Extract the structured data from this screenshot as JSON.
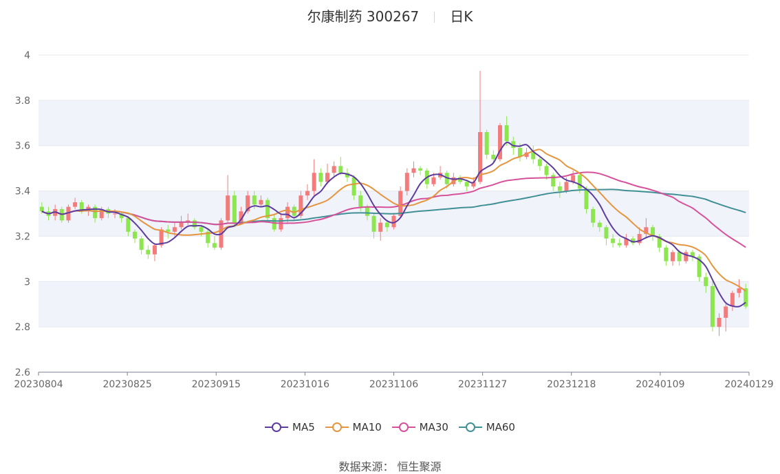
{
  "title": {
    "name": "尔康制药 300267",
    "period": "日K"
  },
  "source": "数据来源： 恒生聚源",
  "colors": {
    "up": "#f37b7b",
    "down": "#8de64f",
    "ma5": "#5b3b9e",
    "ma10": "#e5953f",
    "ma30": "#d6519a",
    "ma60": "#3f8f95",
    "band": "#f1f3fa",
    "grid": "#e6e8f0",
    "axis": "#7a7f8c"
  },
  "chart_data": {
    "type": "candlestick",
    "y_ticks": [
      "4",
      "3.8",
      "3.6",
      "3.4",
      "3.2",
      "3",
      "2.8",
      "2.6"
    ],
    "ylim": [
      2.6,
      4.0
    ],
    "x_ticks": [
      "20230804",
      "20230825",
      "20230915",
      "20231016",
      "20231106",
      "20231127",
      "20231218",
      "20240109",
      "20240129"
    ],
    "legend": [
      "MA5",
      "MA10",
      "MA30",
      "MA60"
    ],
    "candles": [
      [
        3.33,
        3.31,
        3.35,
        3.3
      ],
      [
        3.31,
        3.29,
        3.33,
        3.27
      ],
      [
        3.29,
        3.32,
        3.34,
        3.27
      ],
      [
        3.32,
        3.27,
        3.33,
        3.26
      ],
      [
        3.27,
        3.33,
        3.34,
        3.26
      ],
      [
        3.33,
        3.35,
        3.37,
        3.32
      ],
      [
        3.35,
        3.31,
        3.36,
        3.3
      ],
      [
        3.31,
        3.33,
        3.34,
        3.29
      ],
      [
        3.33,
        3.28,
        3.34,
        3.26
      ],
      [
        3.28,
        3.32,
        3.33,
        3.27
      ],
      [
        3.32,
        3.3,
        3.33,
        3.28
      ],
      [
        3.3,
        3.3,
        3.32,
        3.28
      ],
      [
        3.3,
        3.28,
        3.31,
        3.26
      ],
      [
        3.28,
        3.22,
        3.29,
        3.2
      ],
      [
        3.22,
        3.19,
        3.23,
        3.17
      ],
      [
        3.19,
        3.14,
        3.2,
        3.12
      ],
      [
        3.14,
        3.12,
        3.16,
        3.1
      ],
      [
        3.12,
        3.16,
        3.17,
        3.09
      ],
      [
        3.16,
        3.23,
        3.24,
        3.15
      ],
      [
        3.23,
        3.22,
        3.25,
        3.19
      ],
      [
        3.22,
        3.24,
        3.26,
        3.2
      ],
      [
        3.24,
        3.26,
        3.29,
        3.23
      ],
      [
        3.26,
        3.27,
        3.3,
        3.25
      ],
      [
        3.27,
        3.24,
        3.28,
        3.23
      ],
      [
        3.24,
        3.22,
        3.25,
        3.2
      ],
      [
        3.22,
        3.17,
        3.23,
        3.15
      ],
      [
        3.17,
        3.15,
        3.2,
        3.14
      ],
      [
        3.15,
        3.27,
        3.28,
        3.14
      ],
      [
        3.27,
        3.38,
        3.47,
        3.26
      ],
      [
        3.38,
        3.26,
        3.4,
        3.24
      ],
      [
        3.26,
        3.31,
        3.33,
        3.25
      ],
      [
        3.31,
        3.38,
        3.4,
        3.3
      ],
      [
        3.38,
        3.34,
        3.4,
        3.32
      ],
      [
        3.34,
        3.36,
        3.38,
        3.33
      ],
      [
        3.36,
        3.28,
        3.37,
        3.26
      ],
      [
        3.28,
        3.23,
        3.3,
        3.22
      ],
      [
        3.23,
        3.28,
        3.3,
        3.22
      ],
      [
        3.28,
        3.33,
        3.35,
        3.26
      ],
      [
        3.33,
        3.29,
        3.34,
        3.27
      ],
      [
        3.29,
        3.38,
        3.4,
        3.28
      ],
      [
        3.38,
        3.4,
        3.43,
        3.36
      ],
      [
        3.4,
        3.48,
        3.54,
        3.38
      ],
      [
        3.48,
        3.44,
        3.5,
        3.42
      ],
      [
        3.44,
        3.48,
        3.52,
        3.43
      ],
      [
        3.48,
        3.51,
        3.53,
        3.46
      ],
      [
        3.51,
        3.48,
        3.55,
        3.47
      ],
      [
        3.48,
        3.46,
        3.5,
        3.44
      ],
      [
        3.46,
        3.38,
        3.47,
        3.36
      ],
      [
        3.38,
        3.33,
        3.4,
        3.31
      ],
      [
        3.33,
        3.29,
        3.34,
        3.27
      ],
      [
        3.29,
        3.22,
        3.3,
        3.19
      ],
      [
        3.22,
        3.26,
        3.28,
        3.18
      ],
      [
        3.26,
        3.24,
        3.27,
        3.22
      ],
      [
        3.24,
        3.29,
        3.3,
        3.23
      ],
      [
        3.29,
        3.4,
        3.42,
        3.28
      ],
      [
        3.4,
        3.48,
        3.5,
        3.38
      ],
      [
        3.48,
        3.5,
        3.53,
        3.46
      ],
      [
        3.5,
        3.49,
        3.51,
        3.47
      ],
      [
        3.49,
        3.43,
        3.5,
        3.41
      ],
      [
        3.43,
        3.46,
        3.48,
        3.42
      ],
      [
        3.46,
        3.48,
        3.51,
        3.45
      ],
      [
        3.48,
        3.43,
        3.49,
        3.41
      ],
      [
        3.43,
        3.46,
        3.48,
        3.42
      ],
      [
        3.46,
        3.44,
        3.47,
        3.43
      ],
      [
        3.44,
        3.42,
        3.45,
        3.4
      ],
      [
        3.42,
        3.44,
        3.46,
        3.41
      ],
      [
        3.44,
        3.66,
        3.93,
        3.43
      ],
      [
        3.66,
        3.56,
        3.67,
        3.54
      ],
      [
        3.56,
        3.54,
        3.58,
        3.52
      ],
      [
        3.54,
        3.69,
        3.7,
        3.53
      ],
      [
        3.69,
        3.62,
        3.73,
        3.6
      ],
      [
        3.62,
        3.59,
        3.64,
        3.56
      ],
      [
        3.59,
        3.55,
        3.61,
        3.53
      ],
      [
        3.55,
        3.57,
        3.59,
        3.54
      ],
      [
        3.57,
        3.54,
        3.6,
        3.52
      ],
      [
        3.54,
        3.51,
        3.55,
        3.49
      ],
      [
        3.51,
        3.47,
        3.52,
        3.45
      ],
      [
        3.47,
        3.42,
        3.48,
        3.4
      ],
      [
        3.42,
        3.4,
        3.44,
        3.37
      ],
      [
        3.4,
        3.44,
        3.46,
        3.39
      ],
      [
        3.44,
        3.47,
        3.49,
        3.43
      ],
      [
        3.47,
        3.41,
        3.48,
        3.39
      ],
      [
        3.41,
        3.32,
        3.42,
        3.3
      ],
      [
        3.32,
        3.26,
        3.33,
        3.24
      ],
      [
        3.26,
        3.24,
        3.27,
        3.22
      ],
      [
        3.24,
        3.19,
        3.25,
        3.16
      ],
      [
        3.19,
        3.17,
        3.21,
        3.15
      ],
      [
        3.17,
        3.16,
        3.19,
        3.15
      ],
      [
        3.16,
        3.19,
        3.21,
        3.15
      ],
      [
        3.19,
        3.17,
        3.2,
        3.16
      ],
      [
        3.17,
        3.21,
        3.24,
        3.16
      ],
      [
        3.21,
        3.24,
        3.28,
        3.19
      ],
      [
        3.24,
        3.2,
        3.25,
        3.18
      ],
      [
        3.2,
        3.15,
        3.21,
        3.13
      ],
      [
        3.15,
        3.09,
        3.16,
        3.07
      ],
      [
        3.09,
        3.13,
        3.14,
        3.07
      ],
      [
        3.13,
        3.09,
        3.14,
        3.07
      ],
      [
        3.09,
        3.13,
        3.14,
        3.08
      ],
      [
        3.13,
        3.11,
        3.14,
        3.09
      ],
      [
        3.11,
        3.02,
        3.12,
        3.0
      ],
      [
        3.02,
        2.98,
        3.04,
        2.95
      ],
      [
        2.98,
        2.8,
        3.0,
        2.78
      ],
      [
        2.8,
        2.84,
        2.86,
        2.76
      ],
      [
        2.84,
        2.89,
        2.9,
        2.78
      ],
      [
        2.89,
        2.95,
        2.96,
        2.87
      ],
      [
        2.95,
        2.97,
        3.01,
        2.93
      ],
      [
        2.97,
        2.89,
        2.99,
        2.88
      ]
    ]
  }
}
